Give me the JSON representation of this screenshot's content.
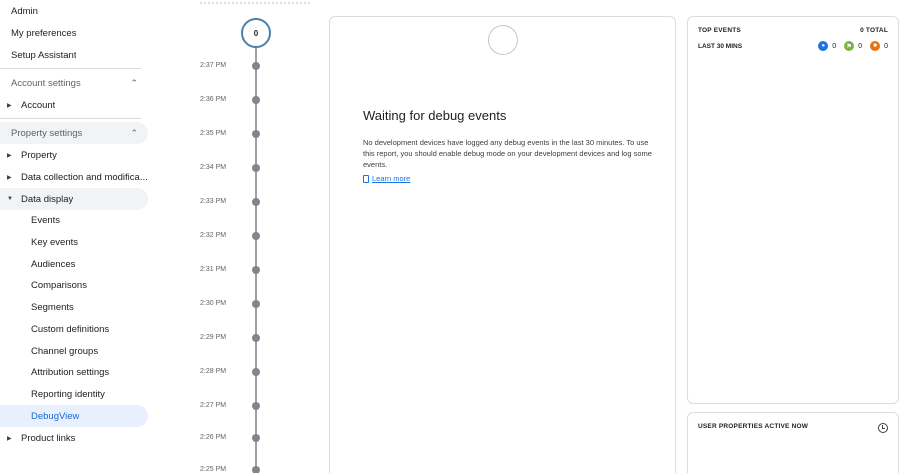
{
  "sidebar": {
    "top_items": [
      "Admin",
      "My preferences",
      "Setup Assistant"
    ],
    "account_settings": {
      "label": "Account settings",
      "chevron": "chevron-up-icon"
    },
    "account_item": "Account",
    "property_settings": {
      "label": "Property settings",
      "chevron": "chevron-up-icon"
    },
    "property_item": "Property",
    "data_collection_item": "Data collection and modifica...",
    "data_display_item": "Data display",
    "data_display_children": [
      "Events",
      "Key events",
      "Audiences",
      "Comparisons",
      "Segments",
      "Custom definitions",
      "Channel groups",
      "Attribution settings",
      "Reporting identity",
      "DebugView"
    ],
    "product_links_item": "Product links"
  },
  "timeline": {
    "top_count": "0",
    "times": [
      "2:37 PM",
      "2:36 PM",
      "2:35 PM",
      "2:34 PM",
      "2:33 PM",
      "2:32 PM",
      "2:31 PM",
      "2:30 PM",
      "2:29 PM",
      "2:28 PM",
      "2:27 PM",
      "2:26 PM",
      "2:25 PM"
    ]
  },
  "main": {
    "title": "Waiting for debug events",
    "description": "No development devices have logged any debug events in the last 30 minutes. To use this report, you should enable debug mode on your development devices and log some events.",
    "learn_more": "Learn more"
  },
  "top_events": {
    "title": "TOP EVENTS",
    "total": "0 TOTAL",
    "row_label": "LAST 30 MINS",
    "counts": [
      {
        "icon": "person-icon",
        "value": "0",
        "color": "#1a73e8"
      },
      {
        "icon": "flag-icon",
        "value": "0",
        "color": "#7cb342"
      },
      {
        "icon": "alert-icon",
        "value": "0",
        "color": "#e8710a"
      }
    ]
  },
  "user_properties": {
    "title": "USER PROPERTIES ACTIVE NOW",
    "icon": "history-icon"
  }
}
